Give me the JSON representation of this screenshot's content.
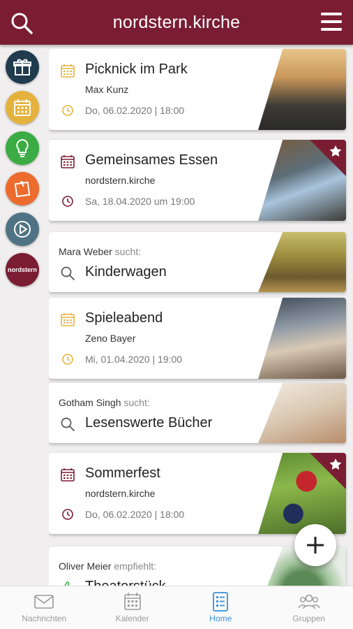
{
  "header": {
    "title": "nordstern.kirche"
  },
  "sidebar": {
    "buttons": [
      {
        "name": "gift",
        "color": "#1f3b4d"
      },
      {
        "name": "calendar",
        "color": "#e5b33d"
      },
      {
        "name": "lightbulb",
        "color": "#3bab43"
      },
      {
        "name": "note",
        "color": "#ec6b2d"
      },
      {
        "name": "play",
        "color": "#4f7384"
      },
      {
        "name": "brand",
        "color": "#7a1d33",
        "label": "nordstern"
      }
    ]
  },
  "cards": [
    {
      "type": "event",
      "title": "Picknick im Park",
      "organizer": "Max Kunz",
      "date": "Do, 06.02.2020 | 18:00",
      "icon_color": "#e5b33d",
      "featured": false
    },
    {
      "type": "event",
      "title": "Gemeinsames Essen",
      "organizer": "nordstern.kirche",
      "date": "Sa, 18.04.2020 um 19:00",
      "icon_color": "#7a1d33",
      "featured": true
    },
    {
      "type": "search",
      "person": "Mara Weber",
      "verb": "sucht:",
      "title": "Kinderwagen"
    },
    {
      "type": "event",
      "title": "Spieleabend",
      "organizer": "Zeno Bayer",
      "date": "Mi, 01.04.2020 | 19:00",
      "icon_color": "#e5b33d",
      "featured": false
    },
    {
      "type": "search",
      "person": "Gotham Singh",
      "verb": "sucht:",
      "title": "Lesenswerte Bücher"
    },
    {
      "type": "event",
      "title": "Sommerfest",
      "organizer": "nordstern.kirche",
      "date": "Do, 06.02.2020 | 18:00",
      "icon_color": "#7a1d33",
      "featured": true
    },
    {
      "type": "recommend",
      "person": "Oliver Meier",
      "verb": "empfiehlt:",
      "title": "Theaterstück"
    }
  ],
  "nav": {
    "tabs": [
      {
        "label": "Nachrichten",
        "active": false
      },
      {
        "label": "Kalender",
        "active": false
      },
      {
        "label": "Home",
        "active": true
      },
      {
        "label": "Gruppen",
        "active": false
      }
    ]
  },
  "colors": {
    "brand": "#7a1d33",
    "active_tab": "#3b8fd9"
  }
}
